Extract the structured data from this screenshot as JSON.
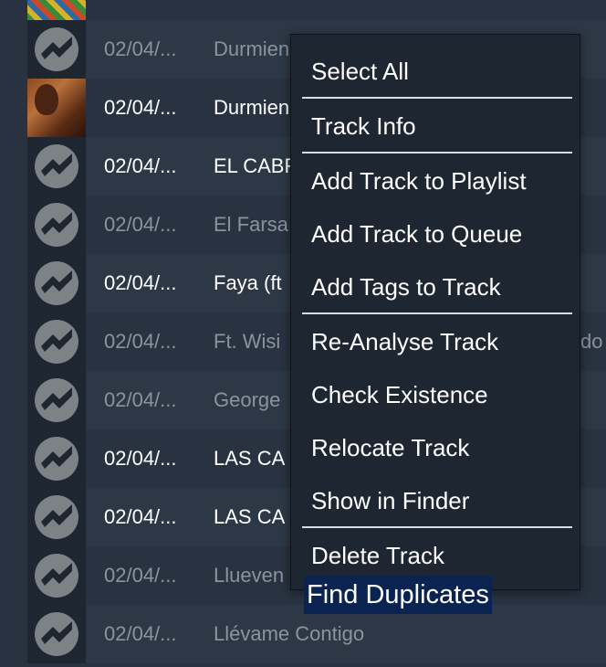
{
  "tracks": [
    {
      "date": "",
      "title": "",
      "art": "colorful-cover",
      "dim": false
    },
    {
      "date": "02/04/...",
      "title": "Durmiend",
      "art": "placeholder-icon",
      "dim": true
    },
    {
      "date": "02/04/...",
      "title": "Durmiend",
      "art": "photo-cover",
      "dim": false
    },
    {
      "date": "02/04/...",
      "title": "EL CABR",
      "art": "placeholder-icon",
      "dim": false
    },
    {
      "date": "02/04/...",
      "title": "El Farsa",
      "art": "placeholder-icon",
      "dim": true
    },
    {
      "date": "02/04/...",
      "title": "Faya (ft",
      "art": "placeholder-icon",
      "dim": false
    },
    {
      "date": "02/04/...",
      "title": "Ft. Wisi",
      "art": "placeholder-icon",
      "dim": true,
      "extra": "do"
    },
    {
      "date": "02/04/...",
      "title": "George",
      "art": "placeholder-icon",
      "dim": true
    },
    {
      "date": "02/04/...",
      "title": "LAS CA",
      "art": "placeholder-icon",
      "dim": false
    },
    {
      "date": "02/04/...",
      "title": "LAS CA",
      "art": "placeholder-icon",
      "dim": false
    },
    {
      "date": "02/04/...",
      "title": "Llueven",
      "art": "placeholder-icon",
      "dim": true
    },
    {
      "date": "02/04/...",
      "title": "Llévame Contigo",
      "art": "placeholder-icon",
      "dim": true
    }
  ],
  "context_menu": {
    "items": [
      {
        "label": "Select All"
      },
      {
        "label": "Track Info"
      },
      {
        "label": "Add Track to Playlist"
      },
      {
        "label": "Add Track to Queue"
      },
      {
        "label": "Add Tags to Track"
      },
      {
        "label": "Re-Analyse Track"
      },
      {
        "label": "Check Existence"
      },
      {
        "label": "Relocate Track"
      },
      {
        "label": "Show in Finder"
      },
      {
        "label": "Delete Track"
      }
    ],
    "highlighted": "Find Duplicates"
  },
  "colors": {
    "background": "#283240",
    "menu_background": "#1e2631",
    "highlight": "#0a2350",
    "dim_text": "#8a939e"
  }
}
